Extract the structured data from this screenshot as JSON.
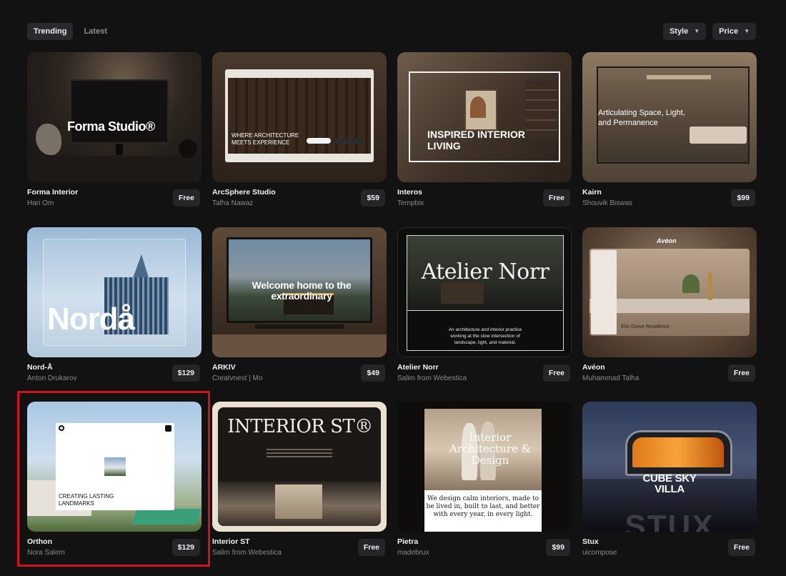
{
  "tabs": [
    {
      "label": "Trending",
      "active": true
    },
    {
      "label": "Latest",
      "active": false
    }
  ],
  "filters": [
    {
      "label": "Style"
    },
    {
      "label": "Price"
    }
  ],
  "cards": [
    {
      "name": "Forma Interior",
      "author": "Hari Om",
      "price": "Free",
      "thumb_text": "Forma Studio®"
    },
    {
      "name": "ArcSphere Studio",
      "author": "Talha Nawaz",
      "price": "$59",
      "thumb_text": "WHERE ARCHITECTURE MEETS EXPERIENCE"
    },
    {
      "name": "Interos",
      "author": "Tempbix",
      "price": "Free",
      "thumb_text": "INSPIRED INTERIOR LIVING"
    },
    {
      "name": "Kairn",
      "author": "Shouvik Biswas",
      "price": "$99",
      "thumb_text": "Articulating Space, Light, and Permanence"
    },
    {
      "name": "Nord-Å",
      "author": "Anton Drukarov",
      "price": "$129",
      "thumb_text": "Nordå"
    },
    {
      "name": "ARKIV",
      "author": "Creatvnest | Mo",
      "price": "$49",
      "thumb_text": "Welcome home to the extraordinary"
    },
    {
      "name": "Atelier Norr",
      "author": "Salim from Webestica",
      "price": "Free",
      "thumb_text": "Atelier Norr",
      "thumb_subtext": "An architecture and interior practice working at the slow intersection of landscape, light, and material."
    },
    {
      "name": "Avéon",
      "author": "Muhammad Talha",
      "price": "Free",
      "thumb_text": "Avéon",
      "thumb_subtext": "Elm Grove Residence"
    },
    {
      "name": "Orthon",
      "author": "Nora Salem",
      "price": "$129",
      "thumb_text": "CREATING LASTING LANDMARKS"
    },
    {
      "name": "Interior ST",
      "author": "Salim from Webestica",
      "price": "Free",
      "thumb_text": "INTERIOR ST®"
    },
    {
      "name": "Pietra",
      "author": "madebrux",
      "price": "$99",
      "thumb_text": "Interior Architecture & Design",
      "thumb_subtext": "We design calm interiors, made to be lived in, built to last, and better with every year, in every light."
    },
    {
      "name": "Stux",
      "author": "uicompose",
      "price": "Free",
      "thumb_text": "CUBE SKY VILLA",
      "thumb_subtext": "STUX"
    }
  ]
}
